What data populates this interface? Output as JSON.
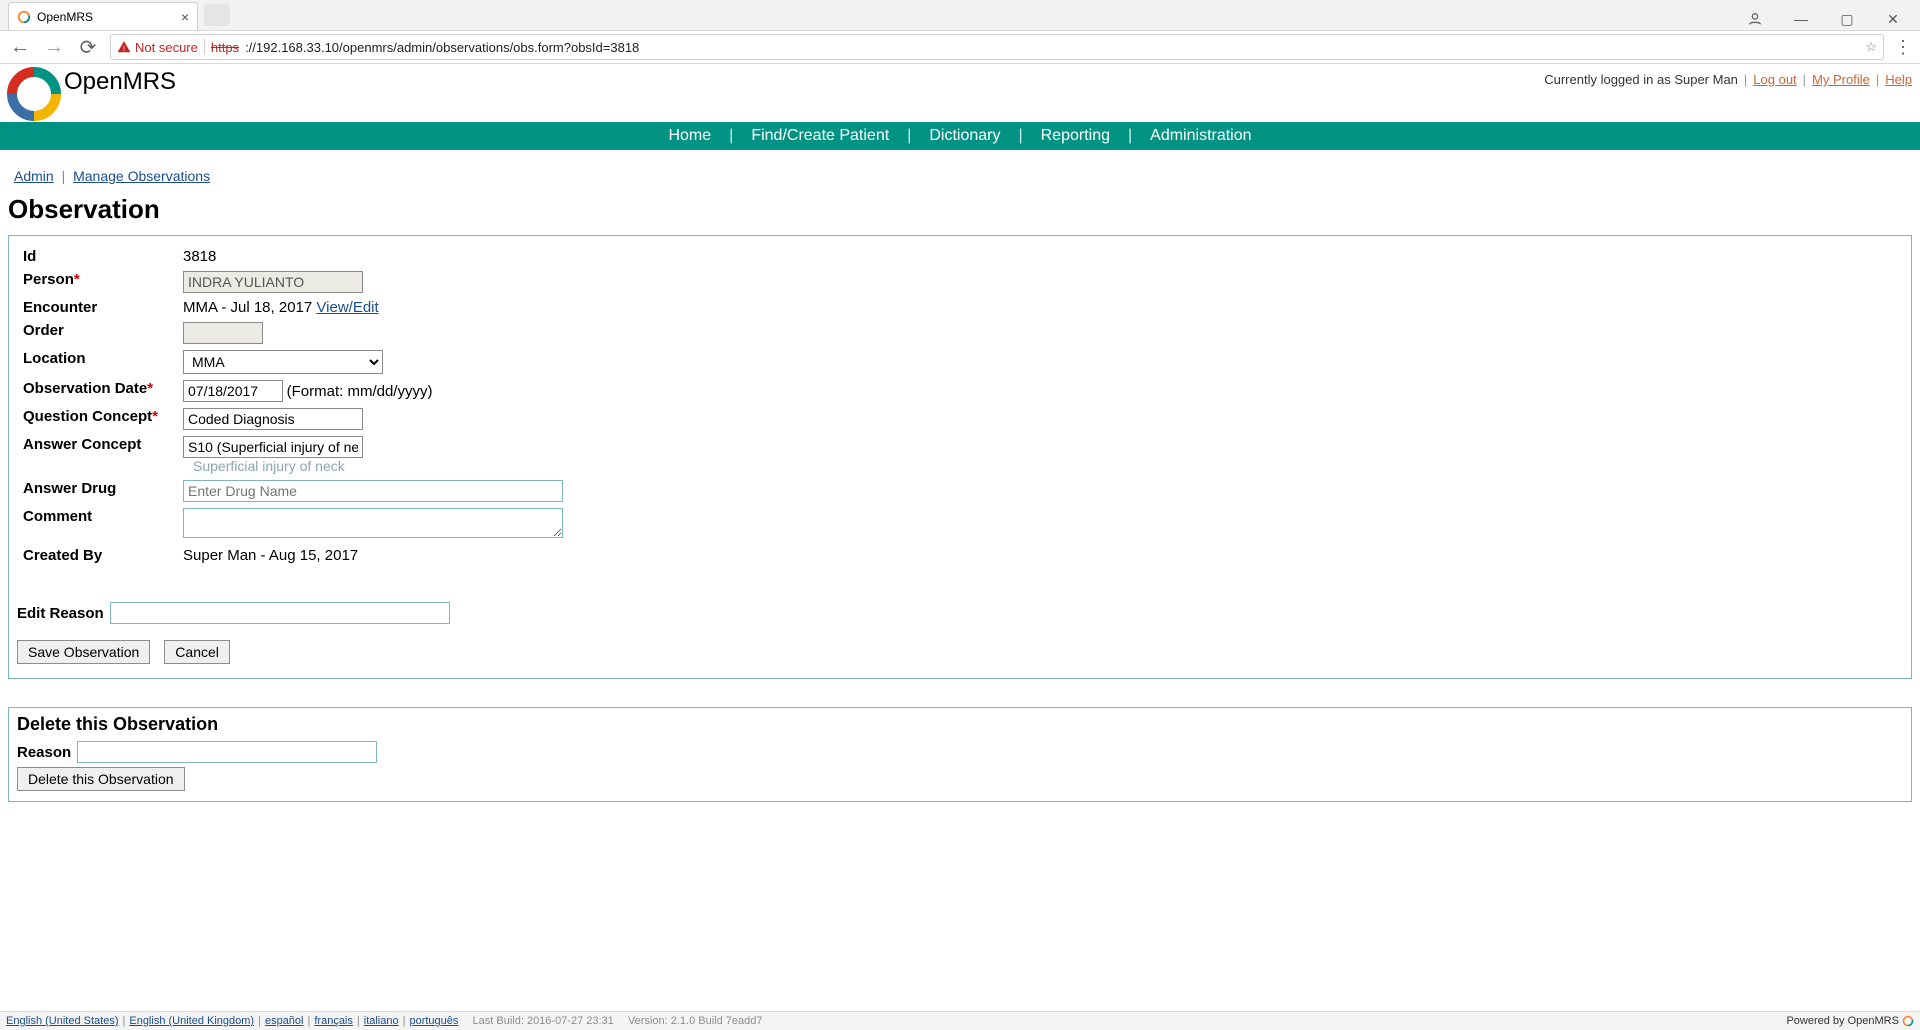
{
  "browser": {
    "tab_title": "OpenMRS",
    "not_secure_label": "Not secure",
    "url_scheme": "https",
    "url_rest": "://192.168.33.10/openmrs/admin/observations/obs.form?obsId=3818"
  },
  "header": {
    "brand": "OpenMRS",
    "logged_in_prefix": "Currently logged in as ",
    "logged_in_user": "Super Man",
    "links": {
      "logout": "Log out",
      "profile": "My Profile",
      "help": "Help"
    },
    "nav": [
      "Home",
      "Find/Create Patient",
      "Dictionary",
      "Reporting",
      "Administration"
    ]
  },
  "breadcrumb": {
    "admin": "Admin",
    "manage": "Manage Observations"
  },
  "page": {
    "title": "Observation"
  },
  "form": {
    "labels": {
      "id": "Id",
      "person": "Person",
      "encounter": "Encounter",
      "order": "Order",
      "location": "Location",
      "obs_date": "Observation Date",
      "qconcept": "Question Concept",
      "aconcept": "Answer Concept",
      "adrug": "Answer Drug",
      "comment": "Comment",
      "created_by": "Created By",
      "edit_reason": "Edit Reason"
    },
    "values": {
      "id": "3818",
      "person": "INDRA YULIANTO",
      "encounter_text": "MMA - Jul 18, 2017 ",
      "encounter_link": "View/Edit",
      "order": "",
      "location": "MMA",
      "obs_date": "07/18/2017",
      "obs_date_hint": "(Format: mm/dd/yyyy)",
      "qconcept": "Coded Diagnosis",
      "aconcept": "S10 (Superficial injury of ne",
      "aconcept_sub": "Superficial injury of neck",
      "adrug_placeholder": "Enter Drug Name",
      "comment": "",
      "created_by": "Super Man - Aug 15, 2017",
      "edit_reason": ""
    },
    "buttons": {
      "save": "Save Observation",
      "cancel": "Cancel"
    }
  },
  "delete": {
    "title": "Delete this Observation",
    "reason_label": "Reason",
    "reason_value": "",
    "button": "Delete this Observation"
  },
  "footer": {
    "langs": [
      "English (United States)",
      "English (United Kingdom)",
      "español",
      "français",
      "italiano",
      "português"
    ],
    "build": "Last Build: 2016-07-27 23:31",
    "version": "Version: 2.1.0 Build 7eadd7",
    "powered": "Powered by OpenMRS"
  }
}
